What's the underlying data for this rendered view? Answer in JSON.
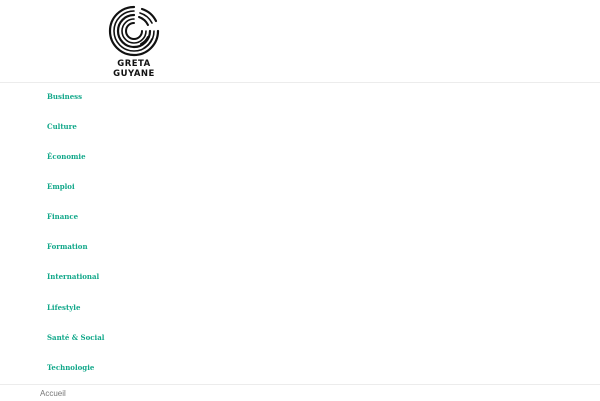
{
  "brand": {
    "name_line1": "GRETA",
    "name_line2": "GUYANE",
    "logo_icon": "circular-arc-logo-icon"
  },
  "colors": {
    "nav_link": "#12a88a",
    "logo": "#111111",
    "breadcrumb": "#777777"
  },
  "nav": {
    "items": [
      {
        "label": "Business"
      },
      {
        "label": "Culture"
      },
      {
        "label": "Économie"
      },
      {
        "label": "Emploi"
      },
      {
        "label": "Finance"
      },
      {
        "label": "Formation"
      },
      {
        "label": "International"
      },
      {
        "label": "Lifestyle"
      },
      {
        "label": "Santé & Social"
      },
      {
        "label": "Technologie"
      }
    ]
  },
  "breadcrumb": {
    "home_label": "Accueil"
  }
}
